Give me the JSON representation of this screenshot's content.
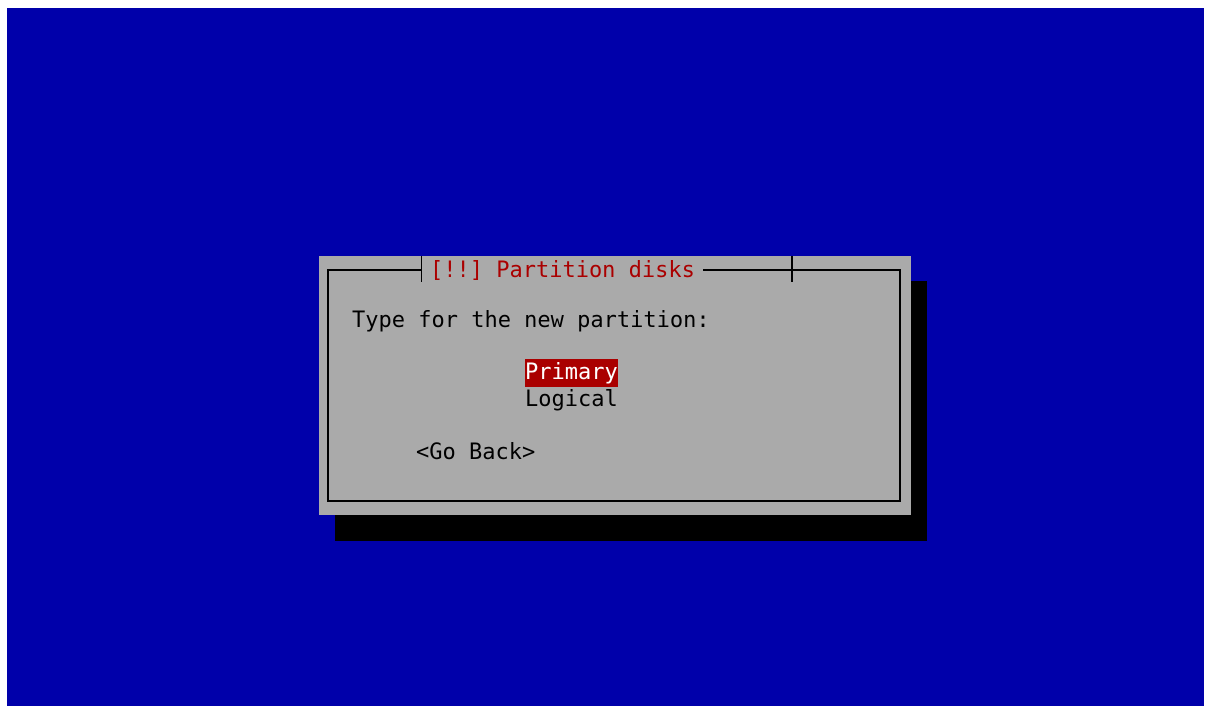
{
  "dialog": {
    "title": "[!!] Partition disks",
    "prompt": "Type for the new partition:",
    "options": [
      {
        "label": "Primary",
        "selected": true
      },
      {
        "label": "Logical",
        "selected": false
      }
    ],
    "back_button": "<Go Back>"
  },
  "colors": {
    "background": "#0000aa",
    "dialog": "#aaaaaa",
    "title": "#aa0000",
    "selection": "#aa0000",
    "shadow": "#000000"
  }
}
